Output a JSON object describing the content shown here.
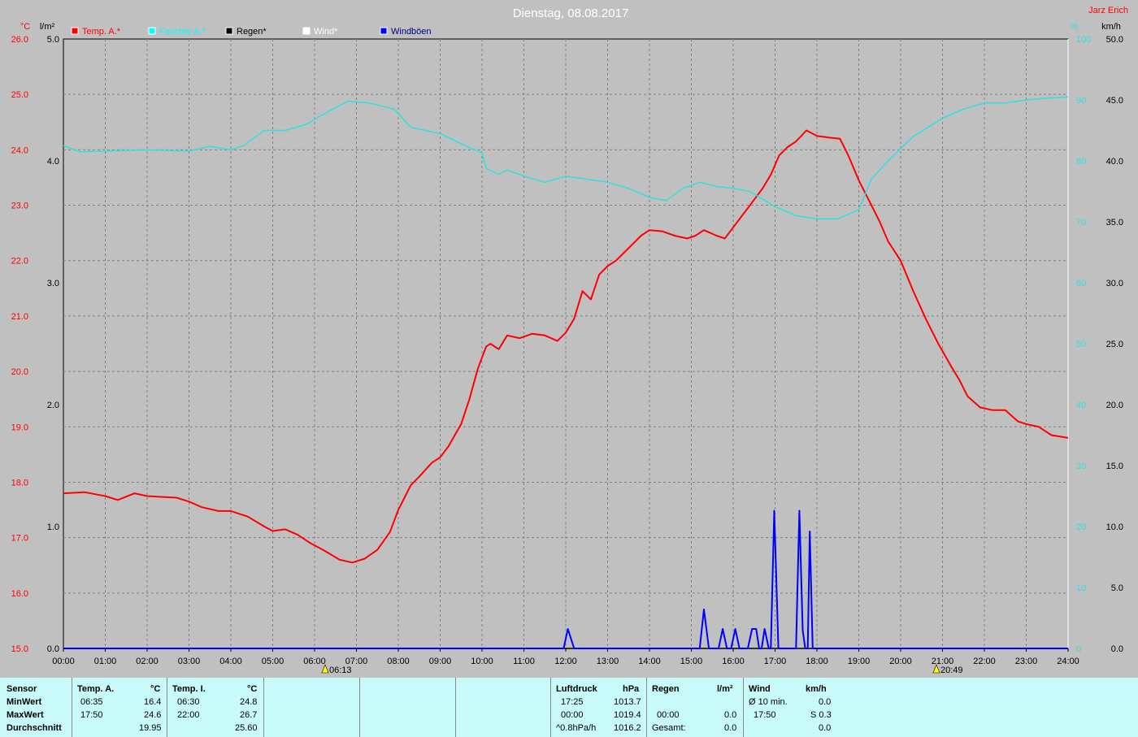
{
  "title": "Dienstag, 08.08.2017",
  "author": "Jarz Erich",
  "axes": {
    "left_temp_unit": "°C",
    "left_rain_unit": "l/m²",
    "right_hum_unit": "%",
    "right_wind_unit": "km/h",
    "temp_ticks": [
      "26.0",
      "25.0",
      "24.0",
      "23.0",
      "22.0",
      "21.0",
      "20.0",
      "19.0",
      "18.0",
      "17.0",
      "16.0",
      "15.0"
    ],
    "rain_ticks": [
      "5.0",
      "4.0",
      "3.0",
      "2.0",
      "1.0",
      "0.0"
    ],
    "hum_ticks": [
      "100",
      "90",
      "80",
      "70",
      "60",
      "50",
      "40",
      "30",
      "20",
      "10",
      "0"
    ],
    "wind_ticks": [
      "50.0",
      "45.0",
      "40.0",
      "35.0",
      "30.0",
      "25.0",
      "20.0",
      "15.0",
      "10.0",
      "5.0",
      "0.0"
    ],
    "x_ticks": [
      "00:00",
      "01:00",
      "02:00",
      "03:00",
      "04:00",
      "05:00",
      "06:00",
      "07:00",
      "08:00",
      "09:00",
      "10:00",
      "11:00",
      "12:00",
      "13:00",
      "14:00",
      "15:00",
      "16:00",
      "17:00",
      "18:00",
      "19:00",
      "20:00",
      "21:00",
      "22:00",
      "23:00",
      "24:00"
    ],
    "sunrise": "06:13",
    "sunset": "20:49"
  },
  "colors": {
    "temp": "#ff0000",
    "humidity": "#30e0e0",
    "rain": "#000000",
    "wind": "#ffffff",
    "gusts": "#0000ff",
    "background": "#c0c0c0"
  },
  "legend": [
    {
      "label": "Temp. A.*",
      "color": "#ff0000"
    },
    {
      "label": "Feuchte A.*",
      "color": "#00ffff"
    },
    {
      "label": "Regen*",
      "color": "#000000"
    },
    {
      "label": "Wind*",
      "color": "#ffffff"
    },
    {
      "label": "Windböen",
      "color": "#0000ff"
    }
  ],
  "chart_data": {
    "type": "line",
    "title": "Dienstag, 08.08.2017",
    "x_unit": "hours",
    "xlim": [
      0,
      24
    ],
    "axes_ranges": {
      "temperature": [
        15.0,
        26.0
      ],
      "rain": [
        0.0,
        5.0
      ],
      "humidity": [
        0,
        100
      ],
      "wind": [
        0.0,
        50.0
      ]
    },
    "grid": true,
    "legend_placement": "top",
    "series": [
      {
        "name": "Temp. A.*",
        "axis": "temperature",
        "points": [
          [
            0.0,
            17.8
          ],
          [
            0.5,
            17.82
          ],
          [
            1.0,
            17.75
          ],
          [
            1.3,
            17.68
          ],
          [
            1.7,
            17.8
          ],
          [
            2.0,
            17.75
          ],
          [
            2.7,
            17.72
          ],
          [
            3.0,
            17.65
          ],
          [
            3.3,
            17.55
          ],
          [
            3.7,
            17.48
          ],
          [
            4.0,
            17.48
          ],
          [
            4.4,
            17.38
          ],
          [
            4.8,
            17.2
          ],
          [
            5.0,
            17.12
          ],
          [
            5.3,
            17.15
          ],
          [
            5.6,
            17.05
          ],
          [
            5.9,
            16.9
          ],
          [
            6.2,
            16.78
          ],
          [
            6.6,
            16.6
          ],
          [
            6.9,
            16.55
          ],
          [
            7.2,
            16.62
          ],
          [
            7.5,
            16.78
          ],
          [
            7.8,
            17.1
          ],
          [
            8.0,
            17.5
          ],
          [
            8.3,
            17.95
          ],
          [
            8.5,
            18.1
          ],
          [
            8.8,
            18.35
          ],
          [
            9.0,
            18.45
          ],
          [
            9.2,
            18.65
          ],
          [
            9.5,
            19.05
          ],
          [
            9.7,
            19.5
          ],
          [
            9.9,
            20.05
          ],
          [
            10.1,
            20.45
          ],
          [
            10.2,
            20.5
          ],
          [
            10.4,
            20.4
          ],
          [
            10.6,
            20.65
          ],
          [
            10.9,
            20.6
          ],
          [
            11.2,
            20.68
          ],
          [
            11.5,
            20.65
          ],
          [
            11.8,
            20.55
          ],
          [
            12.0,
            20.7
          ],
          [
            12.2,
            20.95
          ],
          [
            12.4,
            21.45
          ],
          [
            12.6,
            21.3
          ],
          [
            12.8,
            21.75
          ],
          [
            13.0,
            21.9
          ],
          [
            13.2,
            22.0
          ],
          [
            13.4,
            22.15
          ],
          [
            13.6,
            22.3
          ],
          [
            13.8,
            22.45
          ],
          [
            14.0,
            22.55
          ],
          [
            14.3,
            22.53
          ],
          [
            14.6,
            22.45
          ],
          [
            14.9,
            22.4
          ],
          [
            15.1,
            22.45
          ],
          [
            15.3,
            22.55
          ],
          [
            15.6,
            22.45
          ],
          [
            15.8,
            22.4
          ],
          [
            16.0,
            22.6
          ],
          [
            16.3,
            22.9
          ],
          [
            16.5,
            23.1
          ],
          [
            16.7,
            23.3
          ],
          [
            16.9,
            23.55
          ],
          [
            17.1,
            23.9
          ],
          [
            17.3,
            24.05
          ],
          [
            17.5,
            24.15
          ],
          [
            17.75,
            24.35
          ],
          [
            18.0,
            24.25
          ],
          [
            18.3,
            24.22
          ],
          [
            18.55,
            24.2
          ],
          [
            18.75,
            23.9
          ],
          [
            19.0,
            23.45
          ],
          [
            19.3,
            23.0
          ],
          [
            19.5,
            22.7
          ],
          [
            19.7,
            22.35
          ],
          [
            20.0,
            22.0
          ],
          [
            20.3,
            21.45
          ],
          [
            20.6,
            20.95
          ],
          [
            20.9,
            20.5
          ],
          [
            21.2,
            20.1
          ],
          [
            21.4,
            19.85
          ],
          [
            21.6,
            19.55
          ],
          [
            21.9,
            19.35
          ],
          [
            22.2,
            19.3
          ],
          [
            22.5,
            19.3
          ],
          [
            22.8,
            19.1
          ],
          [
            23.0,
            19.05
          ],
          [
            23.3,
            19.0
          ],
          [
            23.6,
            18.85
          ],
          [
            24.0,
            18.8
          ]
        ]
      },
      {
        "name": "Feuchte A.*",
        "axis": "humidity",
        "points": [
          [
            0.0,
            82.5
          ],
          [
            0.4,
            81.5
          ],
          [
            1.0,
            81.6
          ],
          [
            2.0,
            81.8
          ],
          [
            3.0,
            81.6
          ],
          [
            3.5,
            82.4
          ],
          [
            4.0,
            81.8
          ],
          [
            4.3,
            82.5
          ],
          [
            4.8,
            85.0
          ],
          [
            5.3,
            85.0
          ],
          [
            5.8,
            86.0
          ],
          [
            6.3,
            88.0
          ],
          [
            6.8,
            89.8
          ],
          [
            7.3,
            89.5
          ],
          [
            7.9,
            88.5
          ],
          [
            8.3,
            85.5
          ],
          [
            9.0,
            84.5
          ],
          [
            9.6,
            82.5
          ],
          [
            10.0,
            81.3
          ],
          [
            10.1,
            78.8
          ],
          [
            10.4,
            77.8
          ],
          [
            10.6,
            78.5
          ],
          [
            11.0,
            77.5
          ],
          [
            11.5,
            76.5
          ],
          [
            12.0,
            77.5
          ],
          [
            12.5,
            77.0
          ],
          [
            13.0,
            76.5
          ],
          [
            13.5,
            75.5
          ],
          [
            14.0,
            74.0
          ],
          [
            14.4,
            73.5
          ],
          [
            14.8,
            75.5
          ],
          [
            15.2,
            76.5
          ],
          [
            15.6,
            75.8
          ],
          [
            16.0,
            75.5
          ],
          [
            16.4,
            75.0
          ],
          [
            17.0,
            72.5
          ],
          [
            17.5,
            71.0
          ],
          [
            18.0,
            70.5
          ],
          [
            18.5,
            70.5
          ],
          [
            19.0,
            72.0
          ],
          [
            19.3,
            77.0
          ],
          [
            19.7,
            80.0
          ],
          [
            20.3,
            84.0
          ],
          [
            21.0,
            87.0
          ],
          [
            21.5,
            88.5
          ],
          [
            22.0,
            89.5
          ],
          [
            22.5,
            89.5
          ],
          [
            23.0,
            90.0
          ],
          [
            23.5,
            90.3
          ],
          [
            24.0,
            90.5
          ]
        ]
      },
      {
        "name": "Regen*",
        "axis": "rain",
        "points": [
          [
            0,
            0.0
          ],
          [
            24,
            0.0
          ]
        ]
      },
      {
        "name": "Windböen",
        "axis": "wind",
        "points": [
          [
            0,
            0
          ],
          [
            11.95,
            0
          ],
          [
            12.05,
            1.6
          ],
          [
            12.2,
            0
          ],
          [
            15.2,
            0
          ],
          [
            15.3,
            3.2
          ],
          [
            15.42,
            0
          ],
          [
            15.65,
            0
          ],
          [
            15.75,
            1.6
          ],
          [
            15.85,
            0
          ],
          [
            15.95,
            0
          ],
          [
            16.05,
            1.6
          ],
          [
            16.15,
            0
          ],
          [
            16.35,
            0
          ],
          [
            16.45,
            1.6
          ],
          [
            16.55,
            1.6
          ],
          [
            16.62,
            0
          ],
          [
            16.68,
            0
          ],
          [
            16.75,
            1.6
          ],
          [
            16.85,
            0
          ],
          [
            16.9,
            0
          ],
          [
            16.98,
            11.3
          ],
          [
            17.08,
            0
          ],
          [
            17.5,
            0
          ],
          [
            17.58,
            11.3
          ],
          [
            17.66,
            1.5
          ],
          [
            17.72,
            0
          ],
          [
            17.78,
            0
          ],
          [
            17.83,
            9.6
          ],
          [
            17.9,
            0
          ],
          [
            24,
            0
          ]
        ]
      }
    ]
  },
  "stats": {
    "sensor": {
      "header": "Sensor",
      "rows": [
        "MinWert",
        "MaxWert",
        "Durchschnitt"
      ]
    },
    "temp_a": {
      "header": "Temp. A.",
      "unit": "°C",
      "min_time": "06:35",
      "min": "16.4",
      "max_time": "17:50",
      "max": "24.6",
      "avg": "19.95"
    },
    "temp_i": {
      "header": "Temp. I.",
      "unit": "°C",
      "min_time": "06:30",
      "min": "24.8",
      "max_time": "22:00",
      "max": "26.7",
      "avg": "25.60"
    },
    "luftdruck": {
      "header": "Luftdruck",
      "unit": "hPa",
      "min_time": "17:25",
      "min": "1013.7",
      "max_time": "00:00",
      "max": "1019.4",
      "trend_label": "^0.8hPa/h",
      "avg": "1016.2"
    },
    "regen": {
      "header": "Regen",
      "unit": "l/m²",
      "max_time": "00:00",
      "max": "0.0",
      "total_label": "Gesamt:",
      "total": "0.0"
    },
    "wind": {
      "header": "Wind",
      "unit": "km/h",
      "avg_label": "Ø 10 min.",
      "avg10": "0.0",
      "max_time": "17:50",
      "max": "S 0.3",
      "avg": "0.0"
    }
  }
}
